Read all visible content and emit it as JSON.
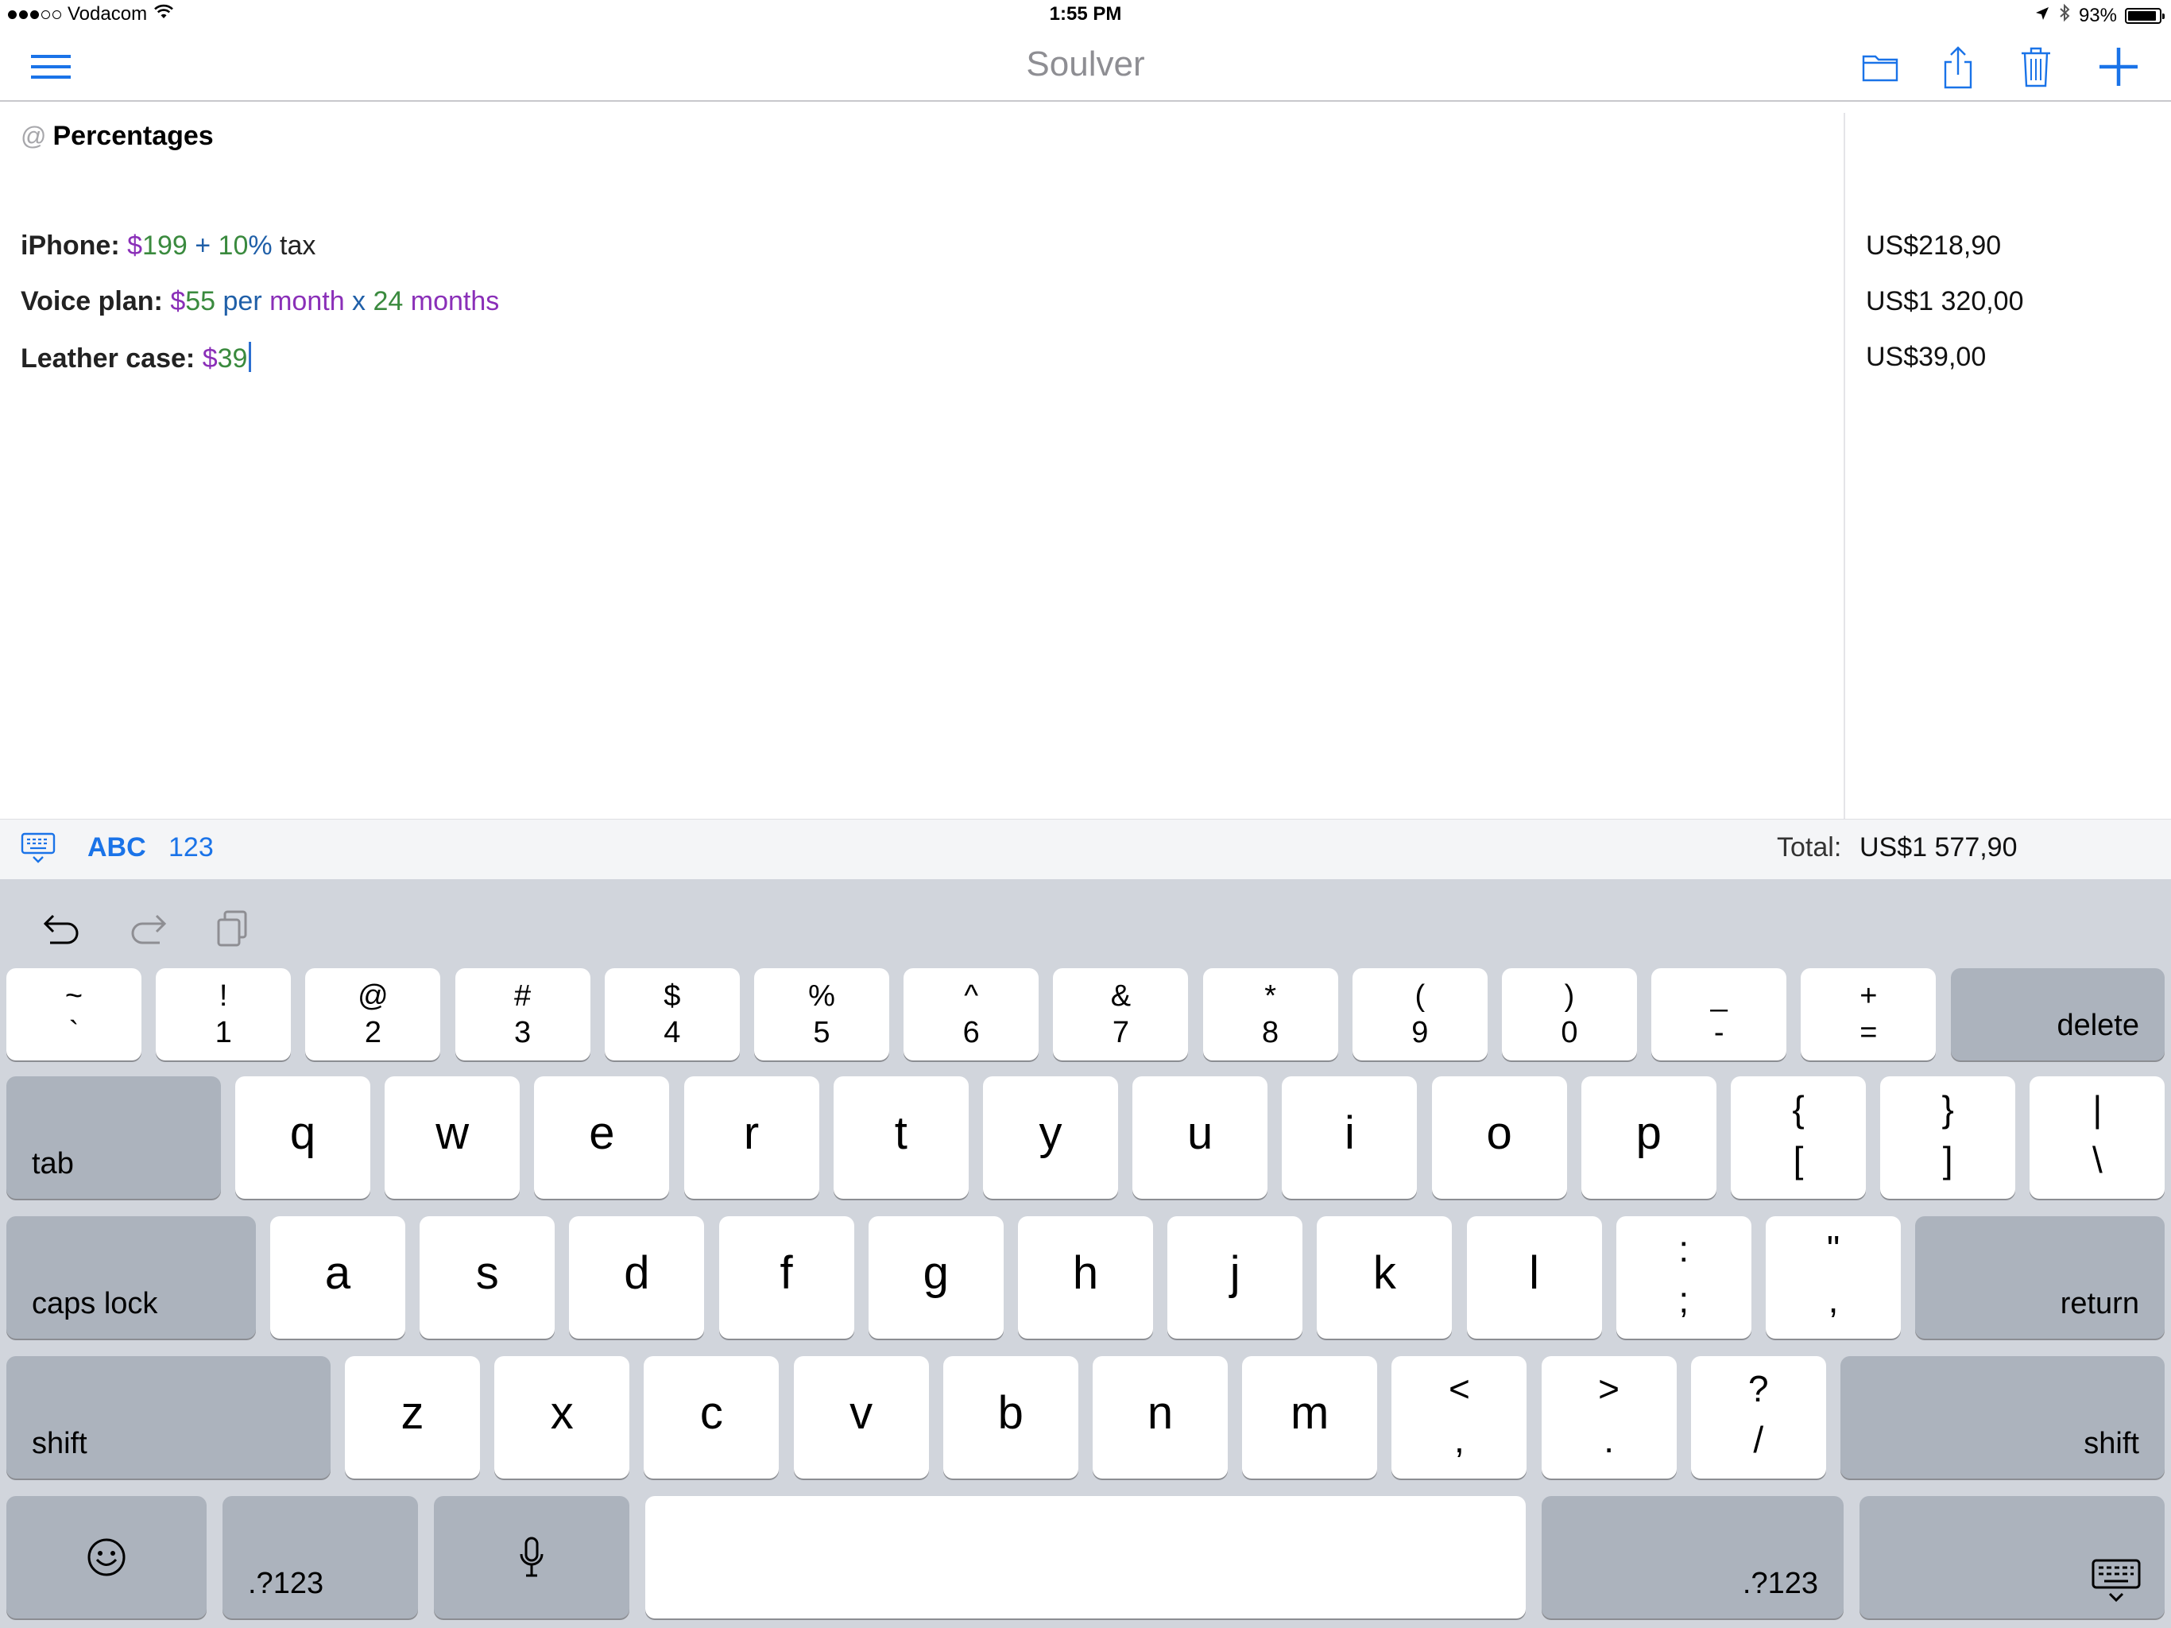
{
  "status_bar": {
    "carrier": "Vodacom",
    "time": "1:55 PM",
    "battery": "93%",
    "battery_level": 0.93,
    "signal_bars": 3,
    "signal_total": 5
  },
  "nav": {
    "title": "Soulver",
    "icons": [
      "menu-icon",
      "folder-icon",
      "share-icon",
      "trash-icon",
      "plus-icon"
    ],
    "accent": "#1a73e8"
  },
  "document": {
    "heading_prefix": "@",
    "heading": "Percentages",
    "lines": [
      {
        "label": "iPhone:",
        "tokens": [
          {
            "text": "$",
            "color": "purple"
          },
          {
            "text": "199",
            "color": "green"
          },
          {
            "text": " + ",
            "color": "blue"
          },
          {
            "text": "10",
            "color": "green"
          },
          {
            "text": "%",
            "color": "blue"
          },
          {
            "text": " tax",
            "color": "black"
          }
        ],
        "result": "US$218,90"
      },
      {
        "label": "Voice plan:",
        "tokens": [
          {
            "text": "$",
            "color": "purple"
          },
          {
            "text": "55",
            "color": "green"
          },
          {
            "text": " per ",
            "color": "blue"
          },
          {
            "text": "month",
            "color": "purple"
          },
          {
            "text": " x ",
            "color": "blue"
          },
          {
            "text": "24",
            "color": "green"
          },
          {
            "text": " months",
            "color": "purple"
          }
        ],
        "result": "US$1 320,00"
      },
      {
        "label": "Leather case:",
        "tokens": [
          {
            "text": "$",
            "color": "purple"
          },
          {
            "text": "39",
            "color": "green"
          }
        ],
        "result": "US$39,00"
      }
    ]
  },
  "accessory": {
    "abc": "ABC",
    "num": "123",
    "total_label": "Total:",
    "total_value": "US$1 577,90"
  },
  "keyboard": {
    "row1": [
      {
        "top": "~",
        "bot": "`"
      },
      {
        "top": "!",
        "bot": "1"
      },
      {
        "top": "@",
        "bot": "2"
      },
      {
        "top": "#",
        "bot": "3"
      },
      {
        "top": "$",
        "bot": "4"
      },
      {
        "top": "%",
        "bot": "5"
      },
      {
        "top": "^",
        "bot": "6"
      },
      {
        "top": "&",
        "bot": "7"
      },
      {
        "top": "*",
        "bot": "8"
      },
      {
        "top": "(",
        "bot": "9"
      },
      {
        "top": ")",
        "bot": "0"
      },
      {
        "top": "_",
        "bot": "-"
      },
      {
        "top": "+",
        "bot": "="
      }
    ],
    "delete": "delete",
    "tab": "tab",
    "row2": [
      "q",
      "w",
      "e",
      "r",
      "t",
      "y",
      "u",
      "i",
      "o",
      "p"
    ],
    "row2_sym": [
      {
        "top": "{",
        "bot": "["
      },
      {
        "top": "}",
        "bot": "]"
      },
      {
        "top": "|",
        "bot": "\\"
      }
    ],
    "caps_lock": "caps lock",
    "row3": [
      "a",
      "s",
      "d",
      "f",
      "g",
      "h",
      "j",
      "k",
      "l"
    ],
    "row3_sym": [
      {
        "top": ":",
        "bot": ";"
      },
      {
        "top": "\"",
        "bot": ","
      }
    ],
    "return": "return",
    "shift": "shift",
    "row4": [
      "z",
      "x",
      "c",
      "v",
      "b",
      "n",
      "m"
    ],
    "row4_sym": [
      {
        "top": "<",
        "bot": ","
      },
      {
        "top": ">",
        "bot": "."
      },
      {
        "top": "?",
        "bot": "/"
      }
    ],
    "num_switch": ".?123",
    "key_bg": "#ffffff",
    "dark_key_bg": "#acb3bd",
    "keyboard_bg": "#d1d5dc"
  }
}
